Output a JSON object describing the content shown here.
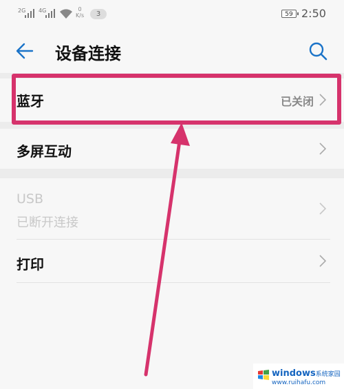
{
  "status_bar": {
    "signal1": "2G",
    "signal2": "4G",
    "speed_value": "0",
    "speed_unit": "K/s",
    "notification_count": "3",
    "battery_level": "59",
    "time": "2:50"
  },
  "header": {
    "title": "设备连接",
    "back_icon": "back-arrow-icon",
    "search_icon": "search-icon"
  },
  "sections": [
    {
      "items": [
        {
          "label": "蓝牙",
          "value": "已关闭",
          "disabled": false
        }
      ]
    },
    {
      "items": [
        {
          "label": "多屏互动",
          "value": "",
          "disabled": false
        }
      ]
    },
    {
      "items": [
        {
          "label": "USB",
          "sublabel": "已断开连接",
          "disabled": true
        },
        {
          "label": "打印",
          "value": "",
          "disabled": false
        }
      ]
    }
  ],
  "annotation": {
    "highlight_color": "#d6336c"
  },
  "watermark": {
    "brand": "windows",
    "suffix": "系统家园",
    "url": "www.ruihafu.com"
  },
  "colors": {
    "background": "#f7f7f7",
    "accent": "#1a73c8",
    "muted_text": "#888888",
    "disabled_text": "#c8c8c8"
  }
}
